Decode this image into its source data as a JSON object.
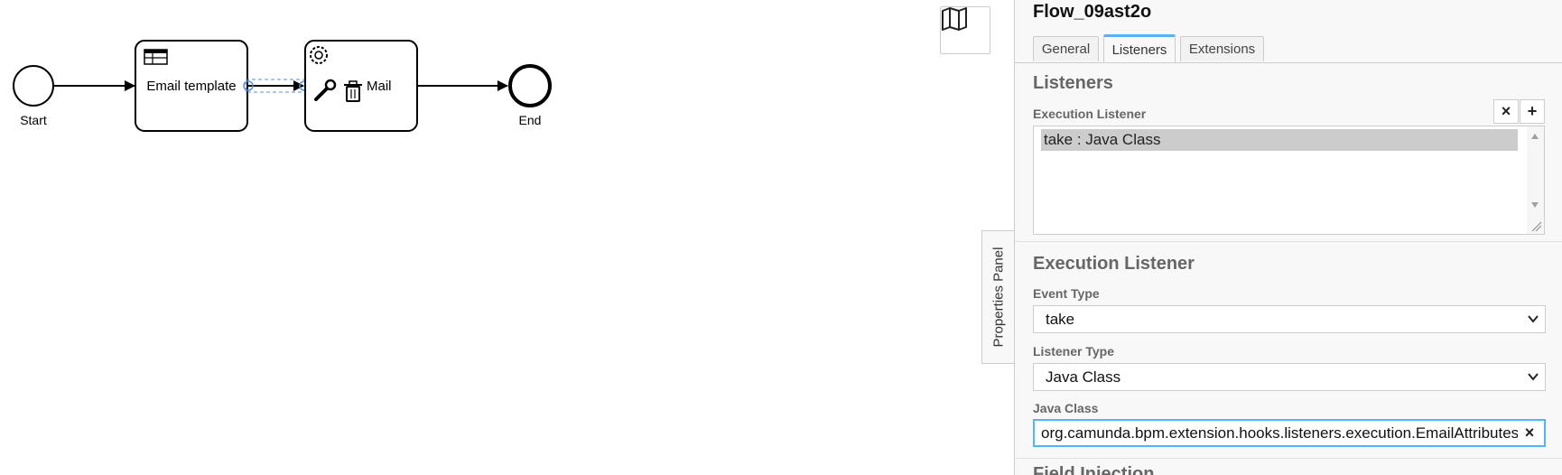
{
  "diagram": {
    "start_label": "Start",
    "email_task_label": "Email template",
    "mail_task_label": "Mail",
    "end_label": "End"
  },
  "canvas": {
    "minimap_icon": "map-icon",
    "properties_panel_toggle": "Properties Panel"
  },
  "panel": {
    "title": "Flow_09ast2o",
    "tabs": [
      {
        "label": "General",
        "active": false
      },
      {
        "label": "Listeners",
        "active": true
      },
      {
        "label": "Extensions",
        "active": false
      }
    ],
    "listeners_group": {
      "title": "Listeners",
      "execution_listener_label": "Execution Listener",
      "remove_label": "×",
      "add_label": "+",
      "items": [
        "take : Java Class"
      ]
    },
    "execution_listener_group": {
      "title": "Execution Listener",
      "event_type_label": "Event Type",
      "event_type_value": "take",
      "listener_type_label": "Listener Type",
      "listener_type_value": "Java Class",
      "java_class_label": "Java Class",
      "java_class_value": "org.camunda.bpm.extension.hooks.listeners.execution.EmailAttributesListener",
      "clear_label": "×"
    },
    "next_group_title": "Field Injection"
  },
  "colors": {
    "focus_blue": "#52b4ff",
    "selection_grey": "#cccccc",
    "panel_bg": "#f8f8f8"
  }
}
